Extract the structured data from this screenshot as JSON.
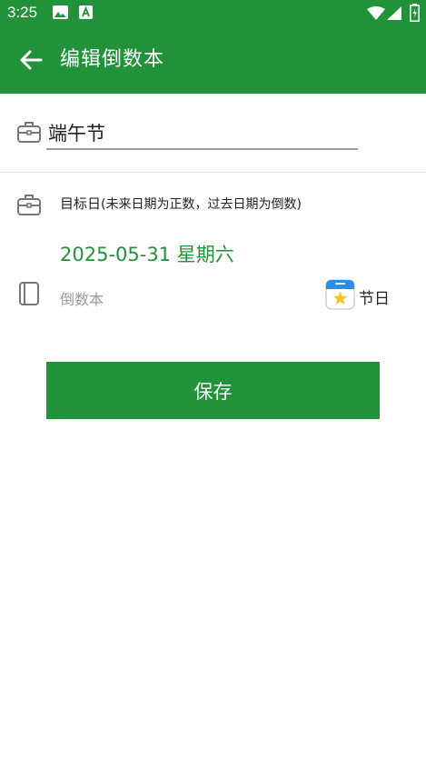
{
  "status_bar": {
    "time": "3:25",
    "icons": [
      "image-icon",
      "a-box-icon",
      "wifi-icon",
      "signal-icon",
      "battery-icon"
    ]
  },
  "app_bar": {
    "title": "编辑倒数本",
    "back_icon": "arrow-left-icon"
  },
  "form": {
    "name_icon": "briefcase-icon",
    "name_value": "端午节",
    "target_icon": "briefcase-icon",
    "target_label": "目标日",
    "target_hint": "(未来日期为正数，过去日期为倒数)",
    "target_date": "2025-05-31 星期六",
    "book_icon": "book-icon",
    "book_name": "倒数本",
    "category_icon": "calendar-star-icon",
    "category_label": "节日"
  },
  "actions": {
    "save_label": "保存"
  },
  "colors": {
    "primary": "#22923a",
    "text": "#222222",
    "hint": "#9a9a9a",
    "divider": "#e3e3e3"
  }
}
